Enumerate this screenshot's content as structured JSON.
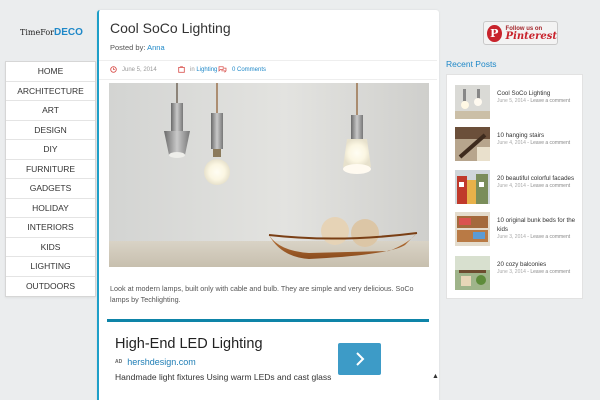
{
  "logo": {
    "part1": "TimeFor",
    "part2": "DECO"
  },
  "nav": {
    "items": [
      {
        "label": "HOME",
        "active": true
      },
      {
        "label": "ARCHITECTURE"
      },
      {
        "label": "ART"
      },
      {
        "label": "DESIGN"
      },
      {
        "label": "DIY"
      },
      {
        "label": "FURNITURE"
      },
      {
        "label": "GADGETS"
      },
      {
        "label": "HOLIDAY"
      },
      {
        "label": "INTERIORS"
      },
      {
        "label": "KIDS"
      },
      {
        "label": "LIGHTING"
      },
      {
        "label": "OUTDOORS"
      }
    ]
  },
  "post": {
    "title": "Cool SoCo Lighting",
    "posted_by_label": "Posted by:",
    "author": "Anna",
    "date": "June 5, 2014",
    "category_prefix": "in",
    "category": "Lighting",
    "comments": "0 Comments",
    "excerpt": "Look at modern lamps, built only with cable and bulb. They are simple and very delicious. SoCo lamps by Techlighting."
  },
  "ad": {
    "title": "High-End LED Lighting",
    "badge": "AD",
    "url": "hershdesign.com",
    "text": "Handmade light fixtures Using warm LEDs and cast glass"
  },
  "sidebar": {
    "pinterest": {
      "follow": "Follow us on",
      "brand": "Pinterest"
    },
    "recent_heading": "Recent Posts",
    "recent": [
      {
        "title": "Cool SoCo Lighting",
        "date": "June 5, 2014",
        "sep": " - ",
        "comment": "Leave a comment"
      },
      {
        "title": "10 hanging stairs",
        "date": "June 4, 2014",
        "sep": " - ",
        "comment": "Leave a comment"
      },
      {
        "title": "20 beautiful colorful facades",
        "date": "June 4, 2014",
        "sep": " - ",
        "comment": "Leave a comment"
      },
      {
        "title": "10 original bunk beds for the kids",
        "date": "June 3, 2014",
        "sep": " - ",
        "comment": "Leave a comment"
      },
      {
        "title": "20 cozy balconies",
        "date": "June 3, 2014",
        "sep": " - ",
        "comment": "Leave a comment"
      }
    ]
  },
  "colors": {
    "accent": "#1e88c8",
    "ad_border": "#0e84a8",
    "cta": "#3d9bc7",
    "pinterest": "#c8232c"
  }
}
